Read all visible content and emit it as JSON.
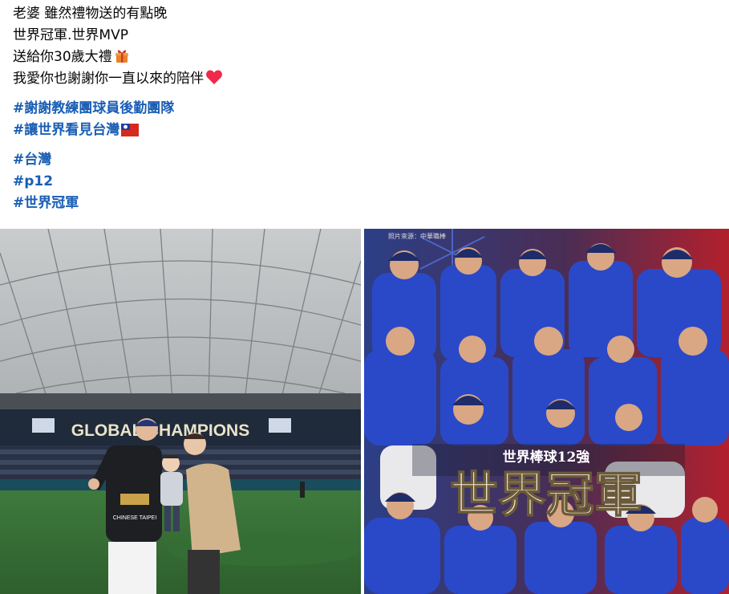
{
  "post": {
    "lines": [
      "老婆 雖然禮物送的有點晚",
      "世界冠軍.世界MVP",
      "送給你30歲大禮",
      "我愛你也謝謝你一直以來的陪伴"
    ],
    "hashtags_group1": [
      "#謝謝教練團球員後勤團隊",
      "#讓世界看見台灣"
    ],
    "hashtags_group2": [
      "#台灣",
      "#p12",
      "#世界冠軍"
    ]
  },
  "photos": {
    "left": {
      "scoreboard_text": "GLOBAL CHAMPIONS",
      "banner_text": "CHINESE TAIPEI"
    },
    "right": {
      "source_text": "照片來源：中華職棒",
      "subtitle": "世界棒球12強",
      "title": "世界冠軍"
    }
  },
  "colors": {
    "hashtag": "#1a5eb5",
    "team_blue": "#2a49c9",
    "poster_red": "#b3202c"
  },
  "icons": [
    "gift-icon",
    "heart-icon",
    "taiwan-flag-icon"
  ]
}
